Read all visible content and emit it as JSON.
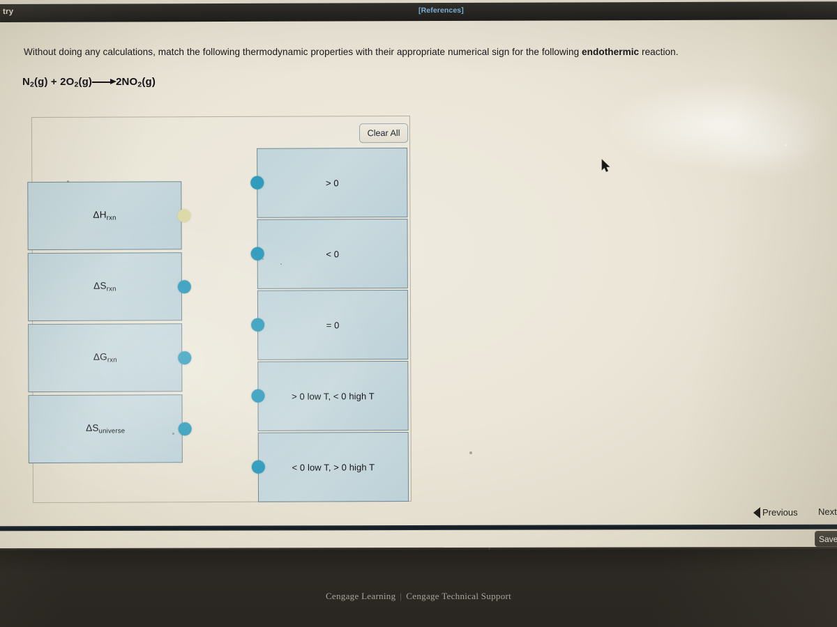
{
  "window": {
    "title_fragment": "try",
    "references_link": "[References]"
  },
  "question": {
    "prompt_before": "Without doing any calculations, match the following thermodynamic properties with their appropriate numerical sign for the following ",
    "prompt_emphasis": "endothermic",
    "prompt_after": " reaction.",
    "equation_plain": "N2(g) + 2O2(g)⟶2NO2(g)",
    "equation_parts": [
      {
        "text": "N",
        "sub": "2"
      },
      {
        "text": "(g) + 2O",
        "sub": "2"
      },
      {
        "text": "(g)",
        "sub": ""
      },
      {
        "text": "2NO",
        "sub": "2"
      },
      {
        "text": "(g)",
        "sub": ""
      }
    ]
  },
  "panel": {
    "clear_all_label": "Clear All",
    "properties": [
      {
        "symbol": "ΔH",
        "sub": "rxn",
        "connector": "empty"
      },
      {
        "symbol": "ΔS",
        "sub": "rxn",
        "connector": "teal"
      },
      {
        "symbol": "ΔG",
        "sub": "rxn",
        "connector": "teal"
      },
      {
        "symbol": "ΔS",
        "sub": "universe",
        "connector": "teal"
      }
    ],
    "answers": [
      {
        "label": "> 0",
        "connector": "teal"
      },
      {
        "label": "< 0",
        "connector": "teal"
      },
      {
        "label": "= 0",
        "connector": "teal"
      },
      {
        "label": "> 0 low T, < 0 high T",
        "connector": "teal"
      },
      {
        "label": "< 0 low T, > 0 high T",
        "connector": "teal"
      }
    ]
  },
  "navigation": {
    "previous_label": "Previous",
    "next_label": "Next",
    "save_label": "Save"
  },
  "footer": {
    "brand": "Cengage Learning",
    "separator": "|",
    "support": "Cengage Technical Support"
  },
  "colors": {
    "tile_fill": "#c2d6dd",
    "tile_border": "#6f8794",
    "connector_teal": "#2f9cbd",
    "connector_empty": "#ddd9a8",
    "topbar": "#24221f",
    "reference_link": "#7ab5e0",
    "page_background": "#ebe6d8"
  }
}
